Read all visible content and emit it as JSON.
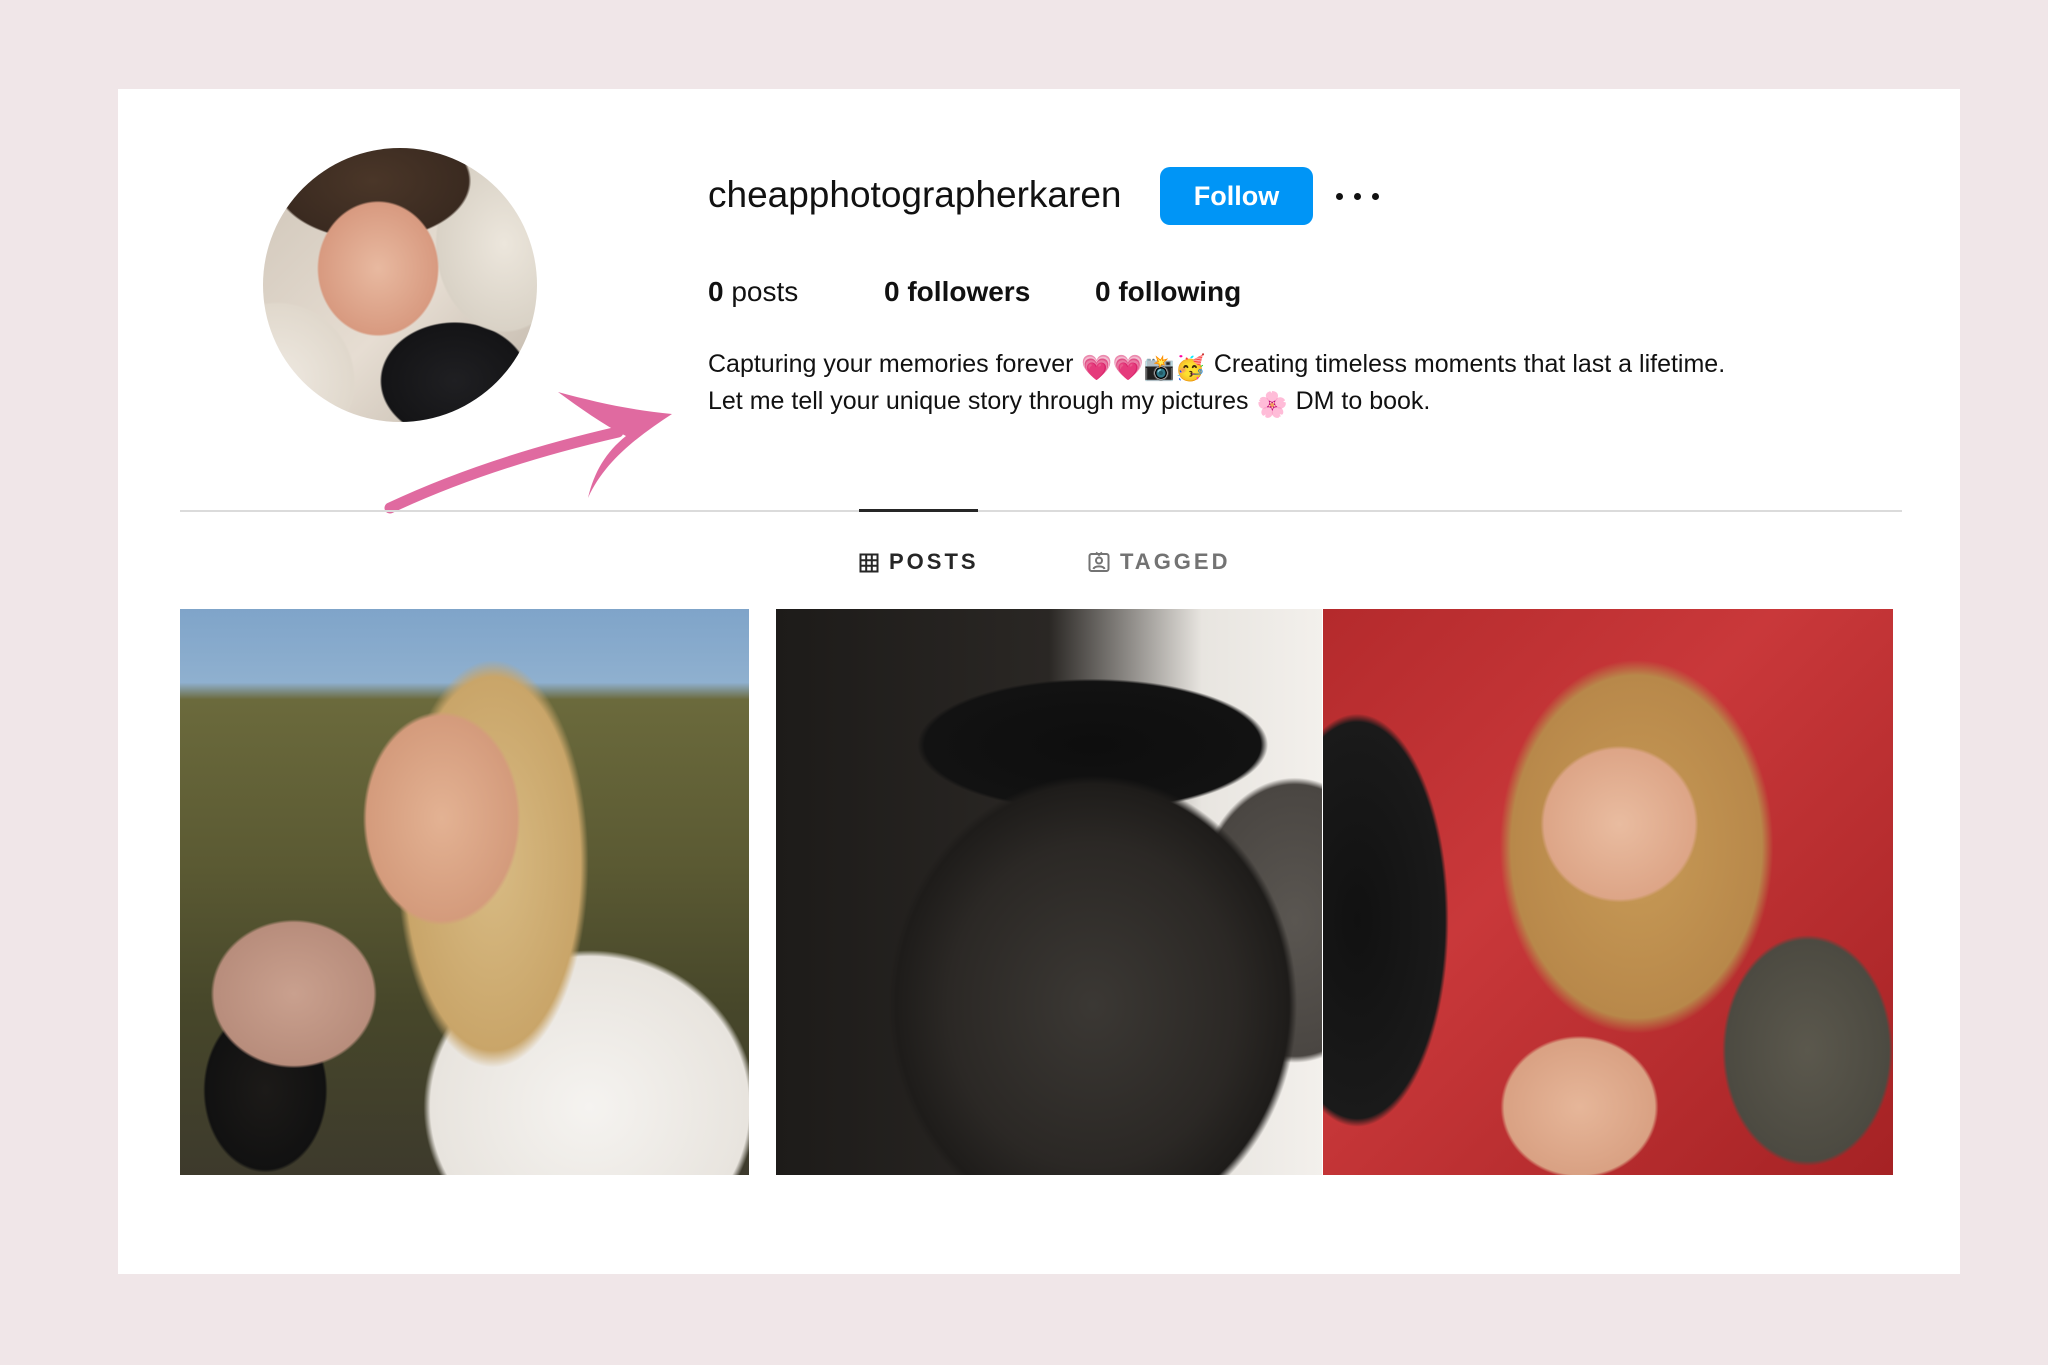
{
  "profile": {
    "username": "cheapphotographerkaren",
    "follow_label": "Follow",
    "more_label": "•••",
    "stats": {
      "posts_count": "0",
      "posts_label": "posts",
      "followers_count": "0",
      "followers_label": "followers",
      "following_count": "0",
      "following_label": "following"
    },
    "bio": {
      "line1_text": "Capturing your memories forever",
      "line1_emojis": "💗💗📸🥳",
      "line1_text_2": "Creating timeless moments that last a lifetime.",
      "line2_text": "Let me tell your unique story through my pictures",
      "line2_emoji": "🌸",
      "line2_text_2": "DM to book."
    }
  },
  "tabs": [
    {
      "label": "POSTS",
      "icon": "grid-icon",
      "active": true
    },
    {
      "label": "TAGGED",
      "icon": "tagged-icon",
      "active": false
    }
  ],
  "posts": [
    {
      "subject": "blonde woman portrait outdoors"
    },
    {
      "subject": "pregnant belly silhouette"
    },
    {
      "subject": "two women lying on red blanket"
    }
  ],
  "colors": {
    "page_background": "#f0e6e8",
    "follow_button": "#0095f6",
    "annotation_arrow": "#e06aa0"
  }
}
